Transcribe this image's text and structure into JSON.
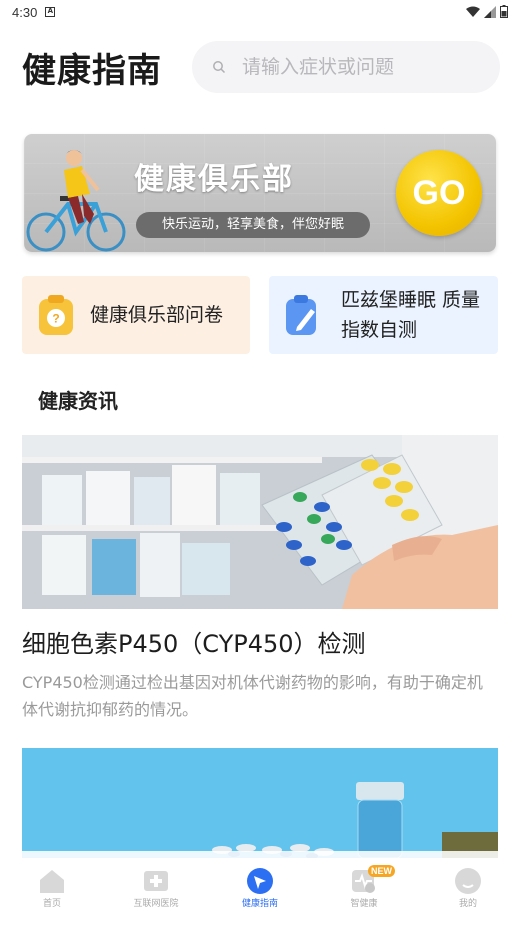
{
  "status_bar": {
    "time": "4:30",
    "notification_letter": "A"
  },
  "header": {
    "title": "健康指南",
    "search_placeholder": "请输入症状或问题"
  },
  "banner": {
    "title": "健康俱乐部",
    "subtitle": "快乐运动，轻享美食，伴您好眠",
    "go_label": "GO"
  },
  "cards": [
    {
      "label": "健康俱乐部问卷",
      "icon": "clipboard-question-icon"
    },
    {
      "label_line1": "匹兹堡睡眠 质量",
      "label_line2": "指数自测",
      "icon": "clipboard-pen-icon"
    }
  ],
  "news": {
    "section_title": "健康资讯",
    "articles": [
      {
        "title": "细胞色素P450（CYP450）检测",
        "summary": "CYP450检测通过检出基因对机体代谢药物的影响，有助于确定机体代谢抗抑郁药的情况。"
      }
    ]
  },
  "bottom_nav": {
    "items": [
      {
        "label": "首页",
        "icon": "home-icon"
      },
      {
        "label": "互联网医院",
        "icon": "medical-cross-icon"
      },
      {
        "label": "健康指南",
        "icon": "compass-icon",
        "active": true
      },
      {
        "label": "智健康",
        "icon": "health-monitor-icon",
        "badge": "NEW"
      },
      {
        "label": "我的",
        "icon": "profile-icon"
      }
    ]
  },
  "colors": {
    "accent": "#2c6ff2",
    "go_yellow": "#f3c400",
    "card_orange_bg": "#fdefe2",
    "card_blue_bg": "#eaf3ff"
  }
}
